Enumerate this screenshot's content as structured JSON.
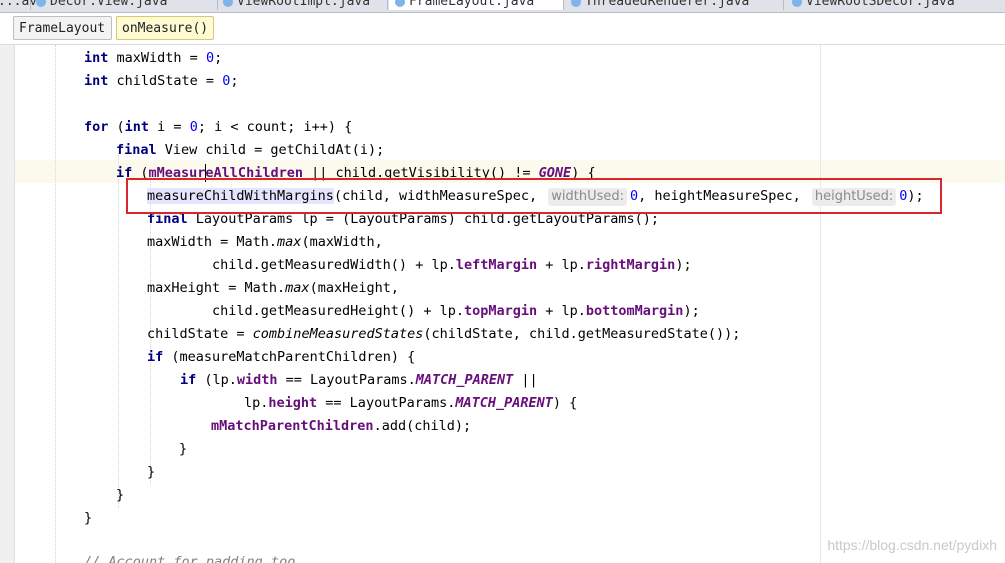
{
  "tabs": [
    {
      "label": "...ava",
      "active": false
    },
    {
      "label": "Decor.View.java",
      "active": false
    },
    {
      "label": "ViewRootImpl.java",
      "active": false
    },
    {
      "label": "FrameLayout.java",
      "active": true
    },
    {
      "label": "ThreadedRenderer.java",
      "active": false
    },
    {
      "label": "ViewRootSDecor.java",
      "active": false
    }
  ],
  "breadcrumbs": {
    "class_name": "FrameLayout",
    "method_name": "onMeasure()"
  },
  "code": {
    "l1": {
      "kw": "int",
      "rest": " maxWidth = ",
      "num": "0",
      "end": ";"
    },
    "l2": {
      "kw": "int",
      "rest": " childState = ",
      "num": "0",
      "end": ";"
    },
    "l3": {
      "kw_for": "for",
      "p1": " (",
      "kw_int": "int",
      "p2": " i = ",
      "num": "0",
      "p3": "; i < count; i++) {"
    },
    "l4": {
      "kw": "final",
      "rest": " View child = getChildAt(i);"
    },
    "l5": {
      "kw": "if",
      "p1": " (",
      "fld": "mMeasureAllChildren",
      "p2": " || child.getVisibility() != ",
      "sfld": "GONE",
      "p3": ") {"
    },
    "l6": {
      "method": "measureChildWithMargins",
      "p1": "(child, widthMeasureSpec, ",
      "hint1": "widthUsed:",
      "num1": "0",
      "p2": ", heightMeasureSpec, ",
      "hint2": "heightUsed:",
      "num2": "0",
      "p3": ");"
    },
    "l7": {
      "kw": "final",
      "rest": " LayoutParams lp = (LayoutParams) child.getLayoutParams();"
    },
    "l8": {
      "p1": "maxWidth = Math.",
      "ital": "max",
      "p2": "(maxWidth,"
    },
    "l9": {
      "p1": "child.getMeasuredWidth() + lp.",
      "fld1": "leftMargin",
      "p2": " + lp.",
      "fld2": "rightMargin",
      "p3": ");"
    },
    "l10": {
      "p1": "maxHeight = Math.",
      "ital": "max",
      "p2": "(maxHeight,"
    },
    "l11": {
      "p1": "child.getMeasuredHeight() + lp.",
      "fld1": "topMargin",
      "p2": " + lp.",
      "fld2": "bottomMargin",
      "p3": ");"
    },
    "l12": {
      "p1": "childState = ",
      "ital": "combineMeasuredStates",
      "p2": "(childState, child.getMeasuredState());"
    },
    "l13": {
      "kw": "if",
      "rest": " (measureMatchParentChildren) {"
    },
    "l14": {
      "kw": "if",
      "p1": " (lp.",
      "fld": "width",
      "p2": " == LayoutParams.",
      "sfld": "MATCH_PARENT",
      "p3": " ||"
    },
    "l15": {
      "p1": "lp.",
      "fld": "height",
      "p2": " == LayoutParams.",
      "sfld": "MATCH_PARENT",
      "p3": ") {"
    },
    "l16": {
      "fld": "mMatchParentChildren",
      "rest": ".add(child);"
    },
    "l17": {
      "text": "}"
    },
    "l18": {
      "text": "}"
    },
    "l19": {
      "text": "}"
    },
    "l20": {
      "text": "}"
    },
    "l21": {
      "text": "// Account for padding too"
    }
  },
  "watermark": "https://blog.csdn.net/pydixh",
  "colors": {
    "keyword": "#000080",
    "number": "#0000ff",
    "field": "#660e7a",
    "highlight_box": "#d9262b",
    "current_line": "#fcfaed"
  }
}
